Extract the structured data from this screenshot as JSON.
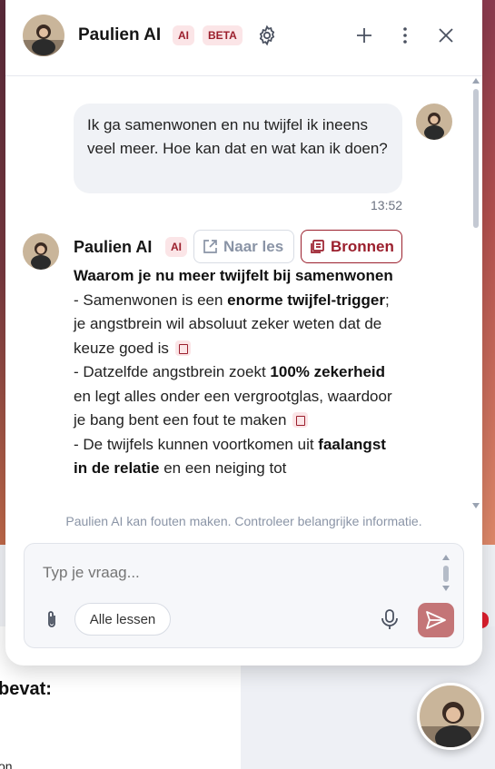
{
  "header": {
    "name": "Paulien AI",
    "ai_badge": "AI",
    "beta_badge": "BETA",
    "icons": [
      "gear-icon",
      "plus-icon",
      "more-vertical-icon",
      "close-icon"
    ]
  },
  "conversation": {
    "user_message": {
      "text": "Ik ga samenwonen en nu twijfel ik ineens veel meer. Hoe kan dat en wat kan ik doen?",
      "time": "13:52"
    },
    "bot_message": {
      "name": "Paulien AI",
      "ai_badge": "AI",
      "naar_les_label": "Naar les",
      "bronnen_label": "Bronnen",
      "heading": "Waarom je nu meer twijfelt bij samenwonen",
      "line1_pre": "- Samenwonen is een ",
      "line1_bold": "enorme twijfel-trigger",
      "line1_post": "; je angstbrein wil absoluut zeker weten dat de keuze goed is",
      "line2_pre": "- Datzelfde angstbrein zoekt ",
      "line2_bold": "100% zekerheid",
      "line2_post": " en legt alles onder een vergrootglas, waardoor je bang bent een fout te maken",
      "line3_pre": "- De twijfels kunnen voortkomen uit ",
      "line3_bold": "faalangst in de relatie",
      "line3_post": " en een neiging tot"
    }
  },
  "disclaimer": "Paulien AI kan fouten maken. Controleer belangrijke informatie.",
  "input": {
    "placeholder": "Typ je vraag...",
    "lessons_button": "Alle lessen"
  },
  "background": {
    "heading_fragment": "bevat:",
    "small_fragment": "on"
  },
  "colors": {
    "accent": "#9b1f2d",
    "badge_bg": "#fbe5e7",
    "send_button": "#c47577"
  }
}
